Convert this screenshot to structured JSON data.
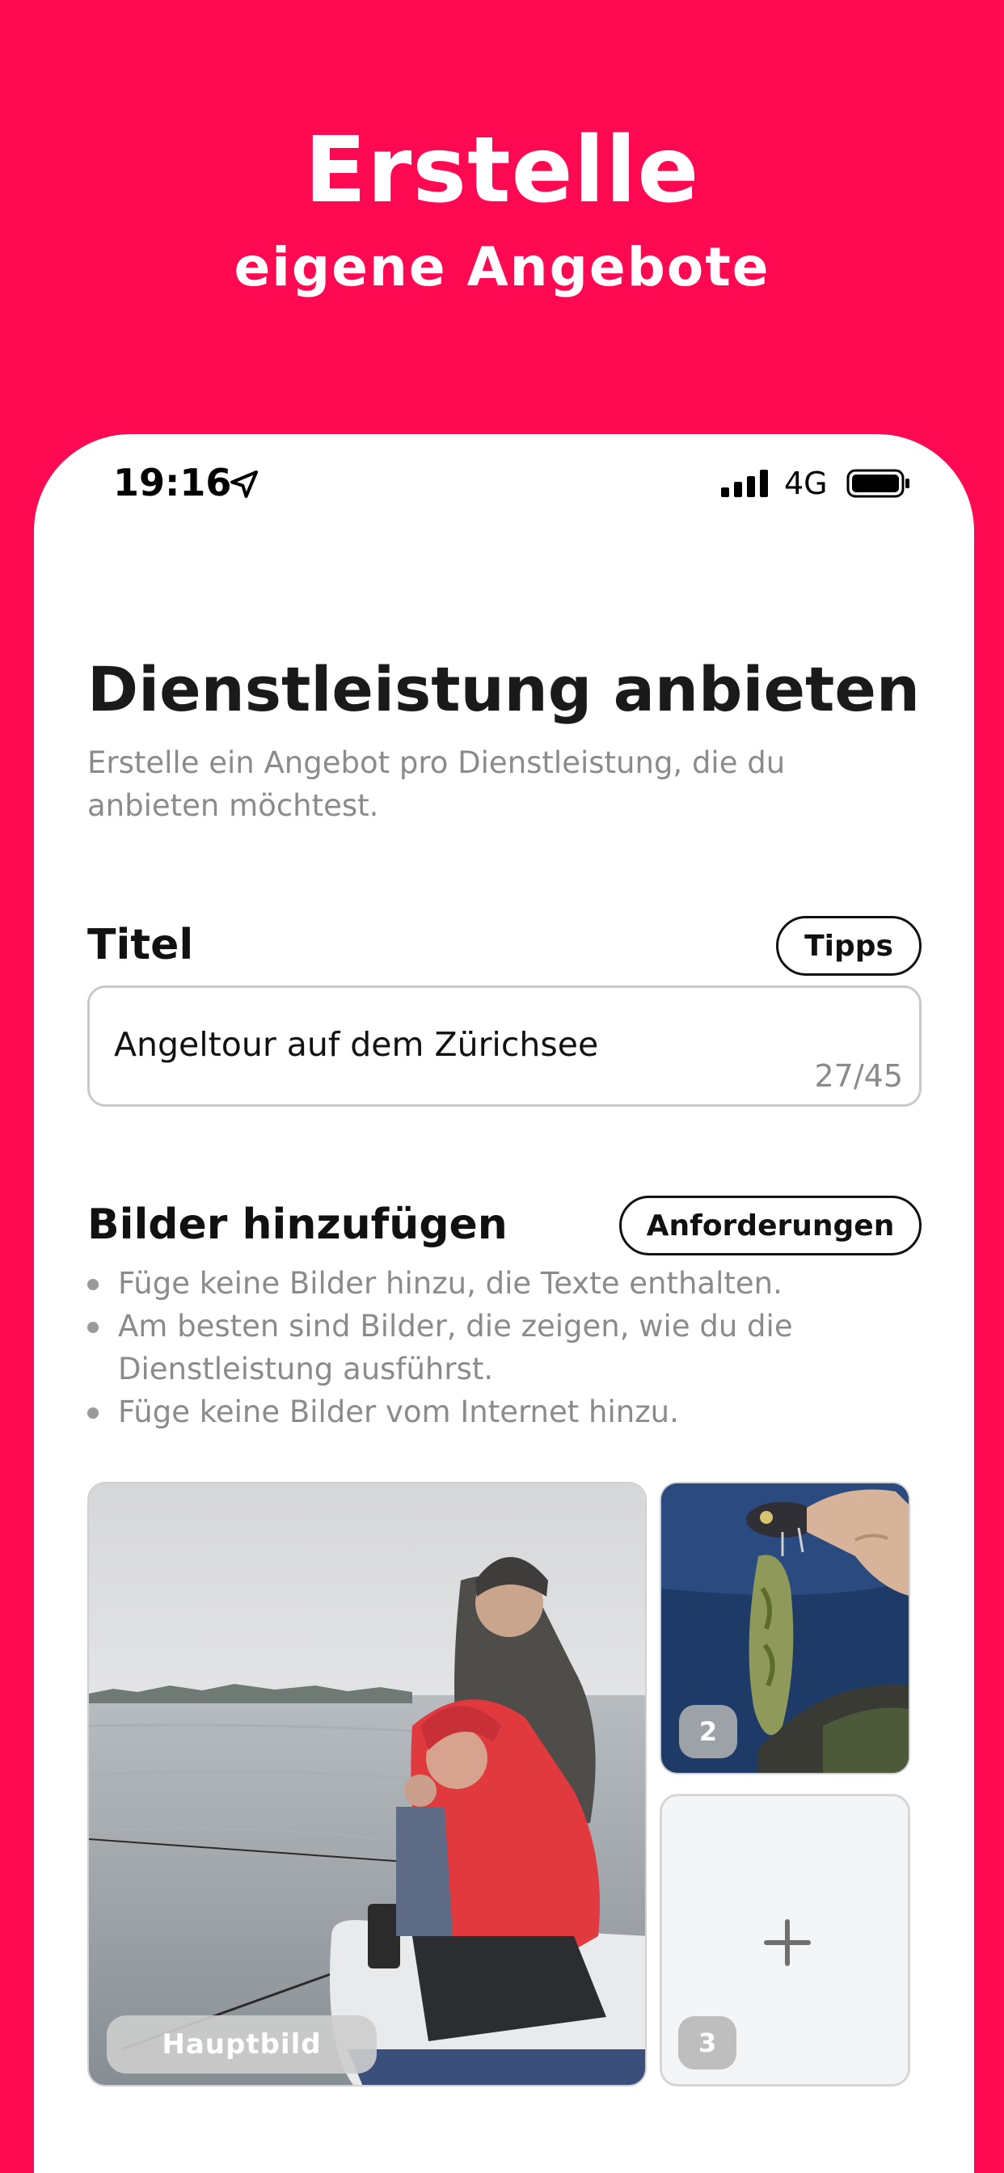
{
  "promo": {
    "title": "Erstelle",
    "subtitle": "eigene Angebote"
  },
  "status_bar": {
    "time": "19:16",
    "network": "4G",
    "location_icon": "location-arrow-icon",
    "signal_icon": "signal-bars-icon",
    "battery_icon": "battery-icon"
  },
  "page": {
    "title": "Dienstleistung anbieten",
    "description": "Erstelle ein Angebot pro Dienstleistung, die du anbieten möchtest."
  },
  "title_section": {
    "label": "Titel",
    "tips_button": "Tipps",
    "input_value": "Angeltour auf dem Zürichsee",
    "char_count": "27/45"
  },
  "images_section": {
    "label": "Bilder hinzufügen",
    "requirements_button": "Anforderungen",
    "bullets": [
      "Füge keine Bilder hinzu, die Texte enthalten.",
      "Am besten sind Bilder, die zeigen, wie du die Dienstleistung ausführst.",
      "Füge keine Bilder vom Internet hinzu."
    ],
    "main_image_label": "Hauptbild",
    "slot2_number": "2",
    "slot3_number": "3",
    "add_icon": "plus-icon"
  },
  "colors": {
    "brand": "#FF0A52",
    "muted_text": "#8b8b8b"
  }
}
